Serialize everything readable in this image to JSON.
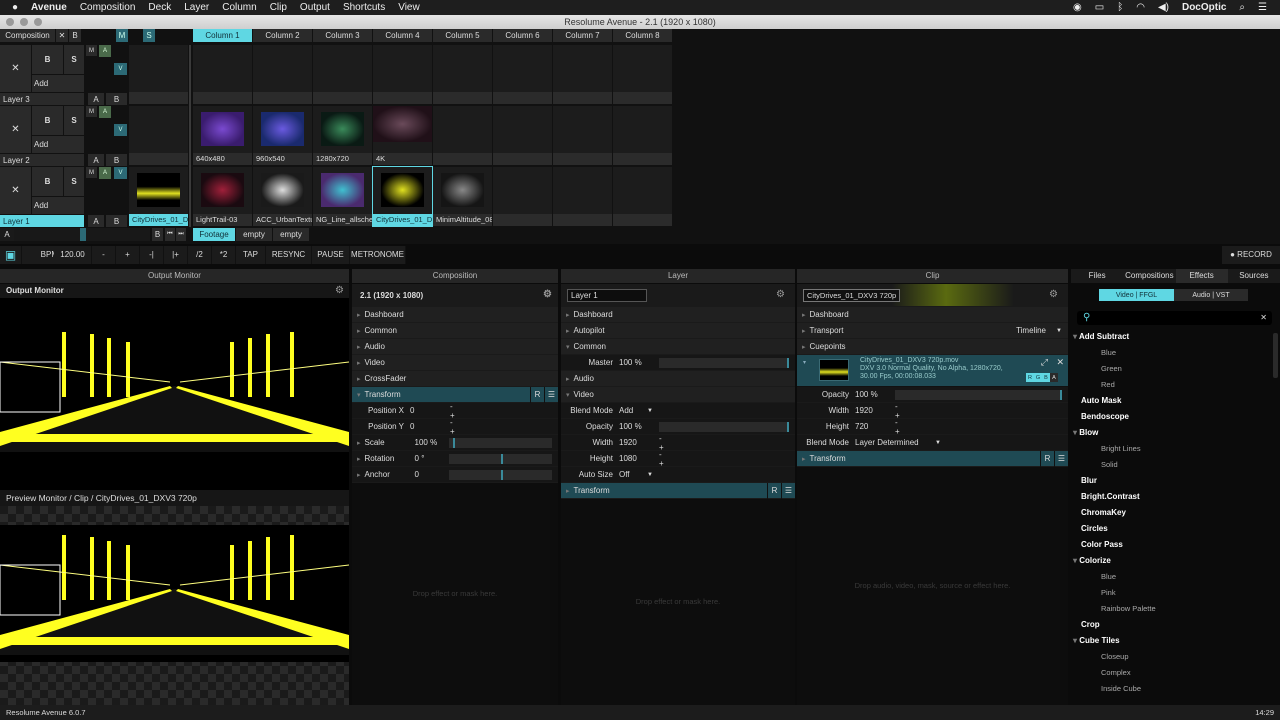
{
  "menubar": {
    "apple": "",
    "app": "Avenue",
    "items": [
      "Composition",
      "Deck",
      "Layer",
      "Column",
      "Clip",
      "Output",
      "Shortcuts",
      "View"
    ],
    "user": "DocOptic"
  },
  "window_title": "Resolume Avenue - 2.1 (1920 x 1080)",
  "deck_header": {
    "composition": "Composition",
    "x": "✕",
    "b": "B",
    "m": "M",
    "s": "S",
    "columns": [
      "Column 1",
      "Column 2",
      "Column 3",
      "Column 4",
      "Column 5",
      "Column 6",
      "Column 7",
      "Column 8"
    ]
  },
  "layer_controls": {
    "x": "✕",
    "b": "B",
    "s": "S",
    "add": "Add",
    "m": "M",
    "a": "A",
    "v": "V",
    "label_a": "A",
    "label_b": "B"
  },
  "layers": [
    {
      "name": "Layer 3",
      "active_clip": "",
      "clips": []
    },
    {
      "name": "Layer 2",
      "active_clip": "",
      "clips": [
        "640x480",
        "960x540",
        "1280x720",
        "4K"
      ]
    },
    {
      "name": "Layer 1",
      "active_clip": "CityDrives_01_DX...",
      "clips": [
        "LightTrail-03",
        "ACC_UrbanTextur...",
        "NG_Line_allscher...",
        "CityDrives_01_DX...",
        "MinimAltitude_08"
      ]
    }
  ],
  "crossfader": {
    "a": "A",
    "b": "B",
    "prev": "⏮",
    "next": "⏭",
    "decks": [
      "Footage",
      "empty",
      "empty"
    ]
  },
  "toolbar": {
    "bpm_label": "BPM",
    "bpm": "120.00",
    "buttons": [
      "-",
      "+",
      "-|",
      "|+",
      "/2",
      "*2",
      "TAP",
      "RESYNC",
      "PAUSE",
      "METRONOME"
    ],
    "record": "● RECORD"
  },
  "output_monitor": {
    "panel_title": "Output Monitor",
    "title": "Output Monitor",
    "preview_title": "Preview Monitor / Clip / CityDrives_01_DXV3 720p"
  },
  "composition": {
    "panel_title": "Composition",
    "name": "2.1 (1920 x 1080)",
    "sections": [
      "Dashboard",
      "Common",
      "Audio",
      "Video",
      "CrossFader"
    ],
    "transform": "Transform",
    "r": "R",
    "menu": "☰",
    "props": [
      {
        "k": "Position X",
        "v": "0",
        "type": "pm"
      },
      {
        "k": "Position Y",
        "v": "0",
        "type": "pm"
      }
    ],
    "sub": [
      {
        "k": "Scale",
        "v": "100 %"
      },
      {
        "k": "Rotation",
        "v": "0 °"
      },
      {
        "k": "Anchor",
        "v": "0"
      }
    ],
    "drop": "Drop effect or mask here."
  },
  "layer": {
    "panel_title": "Layer",
    "name": "Layer 1",
    "dashboard": "Dashboard",
    "autopilot": "Autopilot",
    "common": "Common",
    "master_k": "Master",
    "master_v": "100 %",
    "audio": "Audio",
    "video": "Video",
    "props": [
      {
        "k": "Blend Mode",
        "v": "Add",
        "type": "dd"
      },
      {
        "k": "Opacity",
        "v": "100 %",
        "type": "bar"
      },
      {
        "k": "Width",
        "v": "1920",
        "type": "pm"
      },
      {
        "k": "Height",
        "v": "1080",
        "type": "pm"
      },
      {
        "k": "Auto Size",
        "v": "Off",
        "type": "dd"
      }
    ],
    "transform": "Transform",
    "r": "R",
    "menu": "☰",
    "drop": "Drop effect or mask here."
  },
  "clip": {
    "panel_title": "Clip",
    "name": "CityDrives_01_DXV3 720p",
    "dashboard": "Dashboard",
    "transport": "Transport",
    "timeline": "Timeline",
    "cuepoints": "Cuepoints",
    "file": "CityDrives_01_DXV3 720p.mov",
    "info1": "DXV 3.0 Normal Quality, No Alpha, 1280x720,",
    "info2": "30.00 Fps, 00:00:08.033",
    "rgba": [
      "R",
      "G",
      "B",
      "A"
    ],
    "props": [
      {
        "k": "Opacity",
        "v": "100 %",
        "type": "bar"
      },
      {
        "k": "Width",
        "v": "1920",
        "type": "pm"
      },
      {
        "k": "Height",
        "v": "720",
        "type": "pm"
      },
      {
        "k": "Blend Mode",
        "v": "Layer Determined",
        "type": "dd"
      }
    ],
    "transform": "Transform",
    "r": "R",
    "menu": "☰",
    "drop": "Drop audio, video, mask, source or effect here."
  },
  "browser": {
    "tabs": [
      "Files",
      "Compositions",
      "Effects",
      "Sources"
    ],
    "active_tab": "Effects",
    "toggle": [
      "Video | FFGL",
      "Audio | VST"
    ],
    "search_placeholder": "",
    "effects": [
      {
        "name": "Add Subtract",
        "open": true,
        "presets": [
          "Blue",
          "Green",
          "Red"
        ]
      },
      {
        "name": "Auto Mask"
      },
      {
        "name": "Bendoscope"
      },
      {
        "name": "Blow",
        "open": true,
        "presets": [
          "Bright Lines",
          "Solid"
        ]
      },
      {
        "name": "Blur"
      },
      {
        "name": "Bright.Contrast"
      },
      {
        "name": "ChromaKey"
      },
      {
        "name": "Circles"
      },
      {
        "name": "Color Pass"
      },
      {
        "name": "Colorize",
        "open": true,
        "presets": [
          "Blue",
          "Pink",
          "Rainbow Palette"
        ]
      },
      {
        "name": "Crop"
      },
      {
        "name": "Cube Tiles",
        "open": true,
        "presets": [
          "Closeup",
          "Complex",
          "Inside Cube"
        ]
      }
    ]
  },
  "status": {
    "version": "Resolume Avenue 6.0.7",
    "time": "14:29"
  },
  "colors": {
    "accent": "#5fd7e3",
    "teal": "#1f4a54"
  }
}
